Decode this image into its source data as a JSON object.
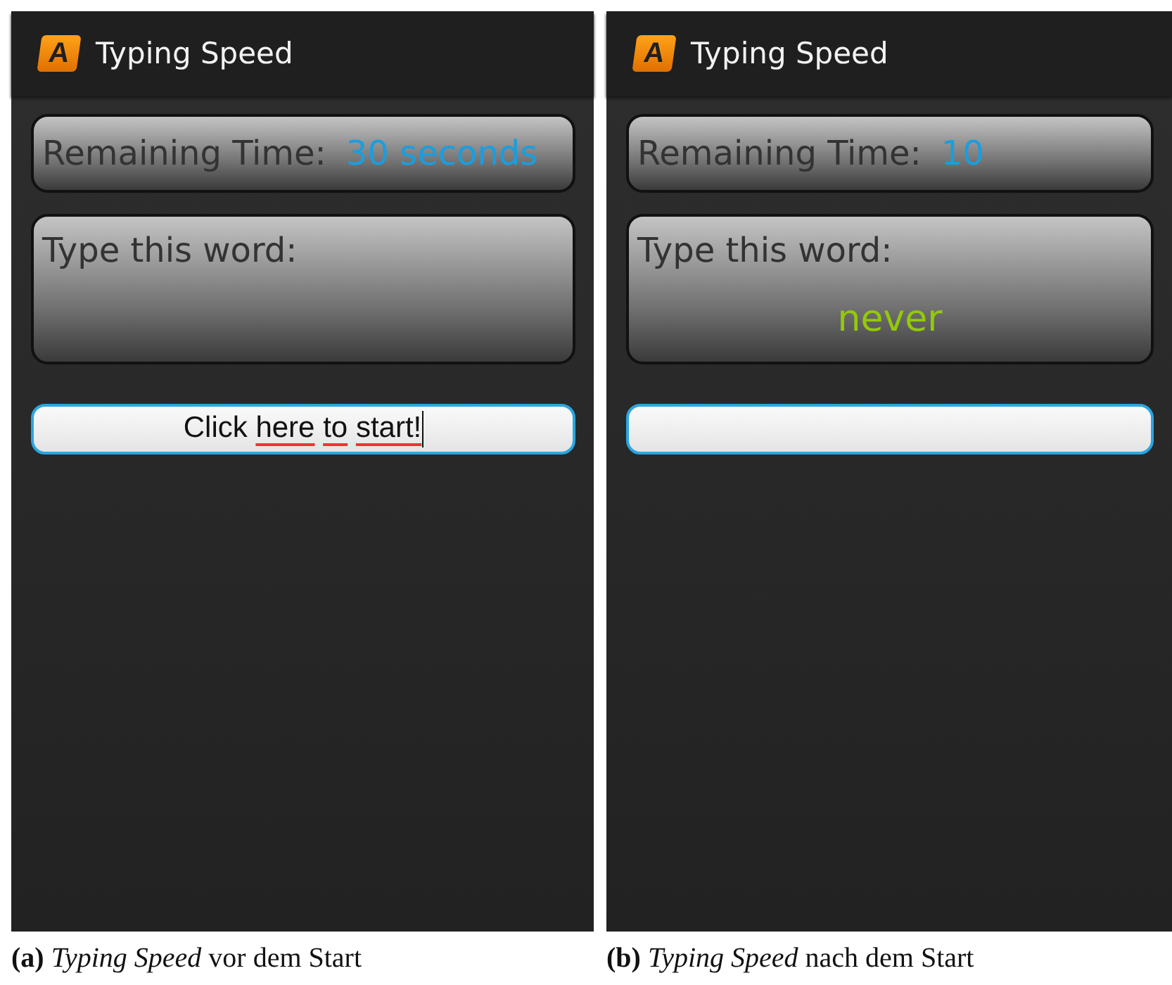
{
  "panels": [
    {
      "app_bar": {
        "logo_letter": "A",
        "title": "Typing Speed"
      },
      "time_card": {
        "label": "Remaining Time:",
        "value": "30 seconds"
      },
      "word_card": {
        "label": "Type this word:"
      },
      "input": {
        "words": [
          {
            "text": "Click",
            "flagged": false
          },
          {
            "text": "here",
            "flagged": true
          },
          {
            "text": "to",
            "flagged": true
          },
          {
            "text": "start!",
            "flagged": true
          }
        ],
        "caret": true
      },
      "caption": "**(a)** *Typing Speed* vor dem Start"
    },
    {
      "app_bar": {
        "logo_letter": "A",
        "title": "Typing Speed"
      },
      "time_card": {
        "label": "Remaining Time:",
        "value": "10"
      },
      "word_card": {
        "label": "Type this word:",
        "word": "never"
      },
      "caption": "**(b)** *Typing Speed* nach dem Start"
    }
  ]
}
